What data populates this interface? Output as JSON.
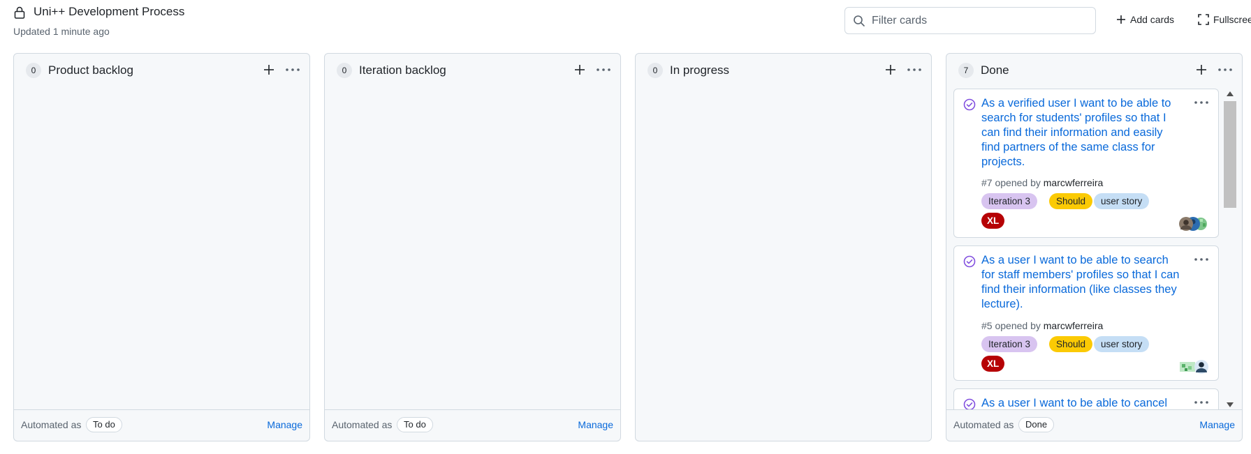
{
  "header": {
    "title": "Uni++ Development Process",
    "updated": "Updated 1 minute ago",
    "filter_placeholder": "Filter cards",
    "add_cards_label": "Add cards",
    "fullscreen_label": "Fullscreen"
  },
  "colors": {
    "link": "#0969da",
    "iteration_label": "#d8c4f0",
    "should_label": "#fbca04",
    "user_story_label": "#c5def5",
    "xl_label": "#b60205",
    "issue_closed": "#8250df"
  },
  "columns": [
    {
      "name": "Product backlog",
      "count": "0",
      "automated_label": "Automated as",
      "automation": "To do",
      "manage_label": "Manage"
    },
    {
      "name": "Iteration backlog",
      "count": "0",
      "automated_label": "Automated as",
      "automation": "To do",
      "manage_label": "Manage"
    },
    {
      "name": "In progress",
      "count": "0"
    },
    {
      "name": "Done",
      "count": "7",
      "automated_label": "Automated as",
      "automation": "Done",
      "manage_label": "Manage",
      "cards": [
        {
          "title": "As a verified user I want to be able to search for students' profiles so that I can find their information and easily find partners of the same class for projects.",
          "number_opened": "#7 opened by",
          "author": "marcwferreira",
          "labels": [
            "Iteration 3",
            "Should",
            "user story",
            "XL"
          ],
          "icon": "issue-closed-icon"
        },
        {
          "title": "As a user I want to be able to search for staff members' profiles so that I can find their information (like classes they lecture).",
          "number_opened": "#5 opened by",
          "author": "marcwferreira",
          "labels": [
            "Iteration 3",
            "Should",
            "user story",
            "XL"
          ],
          "icon": "issue-closed-icon"
        },
        {
          "title": "As a user I want to be able to cancel",
          "icon": "issue-closed-icon"
        }
      ]
    }
  ]
}
